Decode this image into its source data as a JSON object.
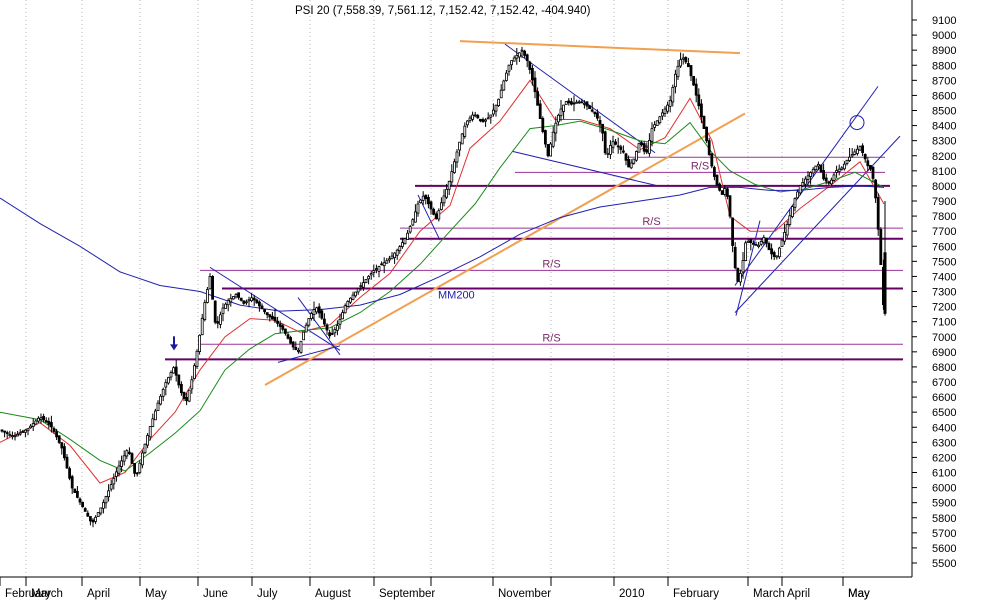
{
  "chart_data": {
    "type": "candlestick",
    "title": "PSI 20 (7,558.39, 7,561.12, 7,152.42, 7,152.42, -404.940)",
    "y_axis_side": "right",
    "ylim": [
      5400,
      9200
    ],
    "y_ticks": [
      5500,
      5600,
      5700,
      5800,
      5900,
      6000,
      6100,
      6200,
      6300,
      6400,
      6500,
      6600,
      6700,
      6800,
      6900,
      7000,
      7100,
      7200,
      7300,
      7400,
      7500,
      7600,
      7700,
      7800,
      7900,
      8000,
      8100,
      8200,
      8300,
      8400,
      8500,
      8600,
      8700,
      8800,
      8900,
      9000,
      9100
    ],
    "x_months": [
      "February",
      "March",
      "April",
      "May",
      "June",
      "July",
      "August",
      "September",
      "",
      "November",
      "",
      "2010",
      "February",
      "March",
      "April",
      "May"
    ],
    "grid": "dotted vertical at month starts",
    "price_path": [
      [
        0,
        6380
      ],
      [
        14,
        6340
      ],
      [
        28,
        6390
      ],
      [
        40,
        6470
      ],
      [
        52,
        6400
      ],
      [
        62,
        6260
      ],
      [
        72,
        6000
      ],
      [
        82,
        5880
      ],
      [
        92,
        5760
      ],
      [
        102,
        5880
      ],
      [
        110,
        6000
      ],
      [
        118,
        6130
      ],
      [
        128,
        6260
      ],
      [
        136,
        6060
      ],
      [
        142,
        6220
      ],
      [
        150,
        6400
      ],
      [
        158,
        6560
      ],
      [
        166,
        6700
      ],
      [
        174,
        6800
      ],
      [
        180,
        6650
      ],
      [
        186,
        6560
      ],
      [
        192,
        6720
      ],
      [
        198,
        6940
      ],
      [
        204,
        7200
      ],
      [
        210,
        7400
      ],
      [
        216,
        7050
      ],
      [
        222,
        7180
      ],
      [
        228,
        7240
      ],
      [
        236,
        7280
      ],
      [
        244,
        7220
      ],
      [
        252,
        7260
      ],
      [
        260,
        7200
      ],
      [
        268,
        7140
      ],
      [
        276,
        7100
      ],
      [
        284,
        7040
      ],
      [
        292,
        6940
      ],
      [
        298,
        6900
      ],
      [
        304,
        7040
      ],
      [
        310,
        7140
      ],
      [
        316,
        7200
      ],
      [
        322,
        7120
      ],
      [
        330,
        7000
      ],
      [
        338,
        7080
      ],
      [
        346,
        7220
      ],
      [
        356,
        7300
      ],
      [
        366,
        7380
      ],
      [
        374,
        7440
      ],
      [
        382,
        7480
      ],
      [
        390,
        7520
      ],
      [
        398,
        7580
      ],
      [
        406,
        7660
      ],
      [
        412,
        7760
      ],
      [
        418,
        7880
      ],
      [
        424,
        7940
      ],
      [
        430,
        7860
      ],
      [
        436,
        7780
      ],
      [
        442,
        7900
      ],
      [
        448,
        8000
      ],
      [
        454,
        8150
      ],
      [
        460,
        8300
      ],
      [
        466,
        8420
      ],
      [
        474,
        8480
      ],
      [
        482,
        8420
      ],
      [
        490,
        8460
      ],
      [
        498,
        8560
      ],
      [
        504,
        8700
      ],
      [
        510,
        8820
      ],
      [
        516,
        8860
      ],
      [
        522,
        8900
      ],
      [
        528,
        8820
      ],
      [
        534,
        8660
      ],
      [
        538,
        8520
      ],
      [
        544,
        8320
      ],
      [
        548,
        8200
      ],
      [
        554,
        8380
      ],
      [
        560,
        8500
      ],
      [
        566,
        8560
      ],
      [
        572,
        8540
      ],
      [
        578,
        8560
      ],
      [
        584,
        8550
      ],
      [
        590,
        8510
      ],
      [
        596,
        8470
      ],
      [
        602,
        8380
      ],
      [
        606,
        8180
      ],
      [
        612,
        8300
      ],
      [
        618,
        8260
      ],
      [
        624,
        8220
      ],
      [
        628,
        8120
      ],
      [
        634,
        8180
      ],
      [
        640,
        8300
      ],
      [
        646,
        8200
      ],
      [
        652,
        8380
      ],
      [
        658,
        8440
      ],
      [
        664,
        8500
      ],
      [
        670,
        8560
      ],
      [
        676,
        8760
      ],
      [
        682,
        8860
      ],
      [
        688,
        8800
      ],
      [
        694,
        8660
      ],
      [
        700,
        8500
      ],
      [
        706,
        8320
      ],
      [
        710,
        8180
      ],
      [
        716,
        8020
      ],
      [
        722,
        7940
      ],
      [
        726,
        8000
      ],
      [
        730,
        7800
      ],
      [
        734,
        7500
      ],
      [
        738,
        7360
      ],
      [
        742,
        7460
      ],
      [
        746,
        7640
      ],
      [
        752,
        7620
      ],
      [
        758,
        7600
      ],
      [
        764,
        7660
      ],
      [
        770,
        7560
      ],
      [
        776,
        7520
      ],
      [
        782,
        7640
      ],
      [
        788,
        7760
      ],
      [
        794,
        7900
      ],
      [
        800,
        8000
      ],
      [
        806,
        8050
      ],
      [
        812,
        8100
      ],
      [
        818,
        8150
      ],
      [
        824,
        8040
      ],
      [
        830,
        8020
      ],
      [
        836,
        8100
      ],
      [
        842,
        8120
      ],
      [
        848,
        8180
      ],
      [
        854,
        8220
      ],
      [
        860,
        8260
      ],
      [
        864,
        8200
      ],
      [
        868,
        8130
      ],
      [
        872,
        8100
      ],
      [
        876,
        7900
      ],
      [
        880,
        7560
      ],
      [
        884,
        7152
      ]
    ],
    "series": [
      {
        "name": "",
        "color": "#e03030",
        "values": [
          [
            0,
            6300
          ],
          [
            40,
            6430
          ],
          [
            70,
            6280
          ],
          [
            100,
            6030
          ],
          [
            125,
            6100
          ],
          [
            150,
            6320
          ],
          [
            175,
            6500
          ],
          [
            200,
            6780
          ],
          [
            225,
            7000
          ],
          [
            250,
            7120
          ],
          [
            275,
            7110
          ],
          [
            300,
            7030
          ],
          [
            330,
            7080
          ],
          [
            360,
            7260
          ],
          [
            390,
            7420
          ],
          [
            420,
            7700
          ],
          [
            450,
            7870
          ],
          [
            470,
            8250
          ],
          [
            500,
            8430
          ],
          [
            530,
            8700
          ],
          [
            555,
            8440
          ],
          [
            580,
            8440
          ],
          [
            610,
            8380
          ],
          [
            640,
            8240
          ],
          [
            665,
            8320
          ],
          [
            690,
            8580
          ],
          [
            712,
            8300
          ],
          [
            730,
            7800
          ],
          [
            750,
            7700
          ],
          [
            775,
            7700
          ],
          [
            800,
            7850
          ],
          [
            830,
            8000
          ],
          [
            860,
            8160
          ],
          [
            884,
            7880
          ]
        ]
      },
      {
        "name": "",
        "color": "#1a8a1a",
        "values": [
          [
            0,
            6500
          ],
          [
            40,
            6450
          ],
          [
            70,
            6320
          ],
          [
            100,
            6180
          ],
          [
            125,
            6110
          ],
          [
            150,
            6230
          ],
          [
            175,
            6360
          ],
          [
            200,
            6510
          ],
          [
            225,
            6780
          ],
          [
            250,
            6920
          ],
          [
            275,
            7020
          ],
          [
            300,
            7040
          ],
          [
            330,
            7060
          ],
          [
            360,
            7160
          ],
          [
            390,
            7300
          ],
          [
            420,
            7480
          ],
          [
            450,
            7700
          ],
          [
            475,
            7880
          ],
          [
            500,
            8120
          ],
          [
            530,
            8380
          ],
          [
            555,
            8400
          ],
          [
            580,
            8430
          ],
          [
            610,
            8370
          ],
          [
            640,
            8300
          ],
          [
            665,
            8280
          ],
          [
            690,
            8420
          ],
          [
            712,
            8220
          ],
          [
            730,
            8100
          ],
          [
            755,
            8010
          ],
          [
            780,
            7960
          ],
          [
            805,
            7980
          ],
          [
            830,
            8030
          ],
          [
            855,
            8090
          ],
          [
            884,
            7990
          ]
        ]
      },
      {
        "name": "MM200",
        "color": "#2020b0",
        "values": [
          [
            0,
            7920
          ],
          [
            40,
            7750
          ],
          [
            80,
            7600
          ],
          [
            120,
            7430
          ],
          [
            160,
            7340
          ],
          [
            200,
            7300
          ],
          [
            240,
            7210
          ],
          [
            280,
            7170
          ],
          [
            320,
            7180
          ],
          [
            360,
            7210
          ],
          [
            400,
            7280
          ],
          [
            440,
            7400
          ],
          [
            480,
            7530
          ],
          [
            520,
            7680
          ],
          [
            560,
            7790
          ],
          [
            600,
            7860
          ],
          [
            640,
            7900
          ],
          [
            680,
            7940
          ],
          [
            710,
            7990
          ],
          [
            740,
            7990
          ],
          [
            770,
            7970
          ],
          [
            800,
            7970
          ],
          [
            830,
            7990
          ],
          [
            860,
            8000
          ],
          [
            884,
            7990
          ]
        ]
      }
    ],
    "support_resistance": [
      {
        "label": "",
        "level": 8000,
        "x0": 415,
        "x1": 890,
        "color": "#660066",
        "width": 2
      },
      {
        "label": "R/S",
        "level": 7720,
        "x0": 400,
        "x1": 903,
        "color": "#993399",
        "width": 1
      },
      {
        "label": "",
        "level": 7650,
        "x0": 400,
        "x1": 903,
        "color": "#660066",
        "width": 2
      },
      {
        "label": "R/S",
        "level": 7440,
        "x0": 200,
        "x1": 903,
        "color": "#993399",
        "width": 1
      },
      {
        "label": "",
        "level": 7320,
        "x0": 222,
        "x1": 903,
        "color": "#660066",
        "width": 2
      },
      {
        "label": "R/S",
        "level": 6950,
        "x0": 200,
        "x1": 903,
        "color": "#993399",
        "width": 1
      },
      {
        "label": "",
        "level": 6850,
        "x0": 165,
        "x1": 903,
        "color": "#660066",
        "width": 2
      },
      {
        "label": "R/S",
        "level": 8090,
        "x0": 515,
        "x1": 885,
        "color": "#993399",
        "width": 1
      },
      {
        "label": "",
        "level": 8190,
        "x0": 625,
        "x1": 885,
        "color": "#993399",
        "width": 1
      }
    ],
    "trendlines": [
      {
        "color": "#f0a050",
        "from": [
          265,
          6680
        ],
        "to": [
          745,
          8480
        ],
        "width": 2
      },
      {
        "color": "#f0a050",
        "from": [
          460,
          8960
        ],
        "to": [
          740,
          8880
        ],
        "width": 2
      },
      {
        "color": "#2020b0",
        "from": [
          505,
          8940
        ],
        "to": [
          655,
          8220
        ],
        "width": 1
      },
      {
        "color": "#2020b0",
        "from": [
          512,
          8230
        ],
        "to": [
          658,
          8000
        ],
        "width": 1
      },
      {
        "color": "#2020b0",
        "from": [
          210,
          7460
        ],
        "to": [
          340,
          6910
        ],
        "width": 1
      },
      {
        "color": "#2020b0",
        "from": [
          298,
          7260
        ],
        "to": [
          340,
          6880
        ],
        "width": 1
      },
      {
        "color": "#2020b0",
        "from": [
          278,
          6830
        ],
        "to": [
          340,
          6940
        ],
        "width": 1
      },
      {
        "color": "#2020b0",
        "from": [
          418,
          7940
        ],
        "to": [
          440,
          7640
        ],
        "width": 1
      },
      {
        "color": "#2020b0",
        "from": [
          735,
          7160
        ],
        "to": [
          900,
          8330
        ],
        "width": 1
      },
      {
        "color": "#2020b0",
        "from": [
          735,
          7340
        ],
        "to": [
          878,
          8660
        ],
        "width": 1
      },
      {
        "color": "#2020b0",
        "from": [
          736,
          7140
        ],
        "to": [
          760,
          7770
        ],
        "width": 1
      }
    ],
    "annotations": [
      {
        "type": "arrow",
        "color": "#1a1aa0",
        "x": 174,
        "level": 6910
      },
      {
        "type": "circle",
        "color": "#2020b0",
        "x": 857,
        "level": 8420
      }
    ]
  }
}
